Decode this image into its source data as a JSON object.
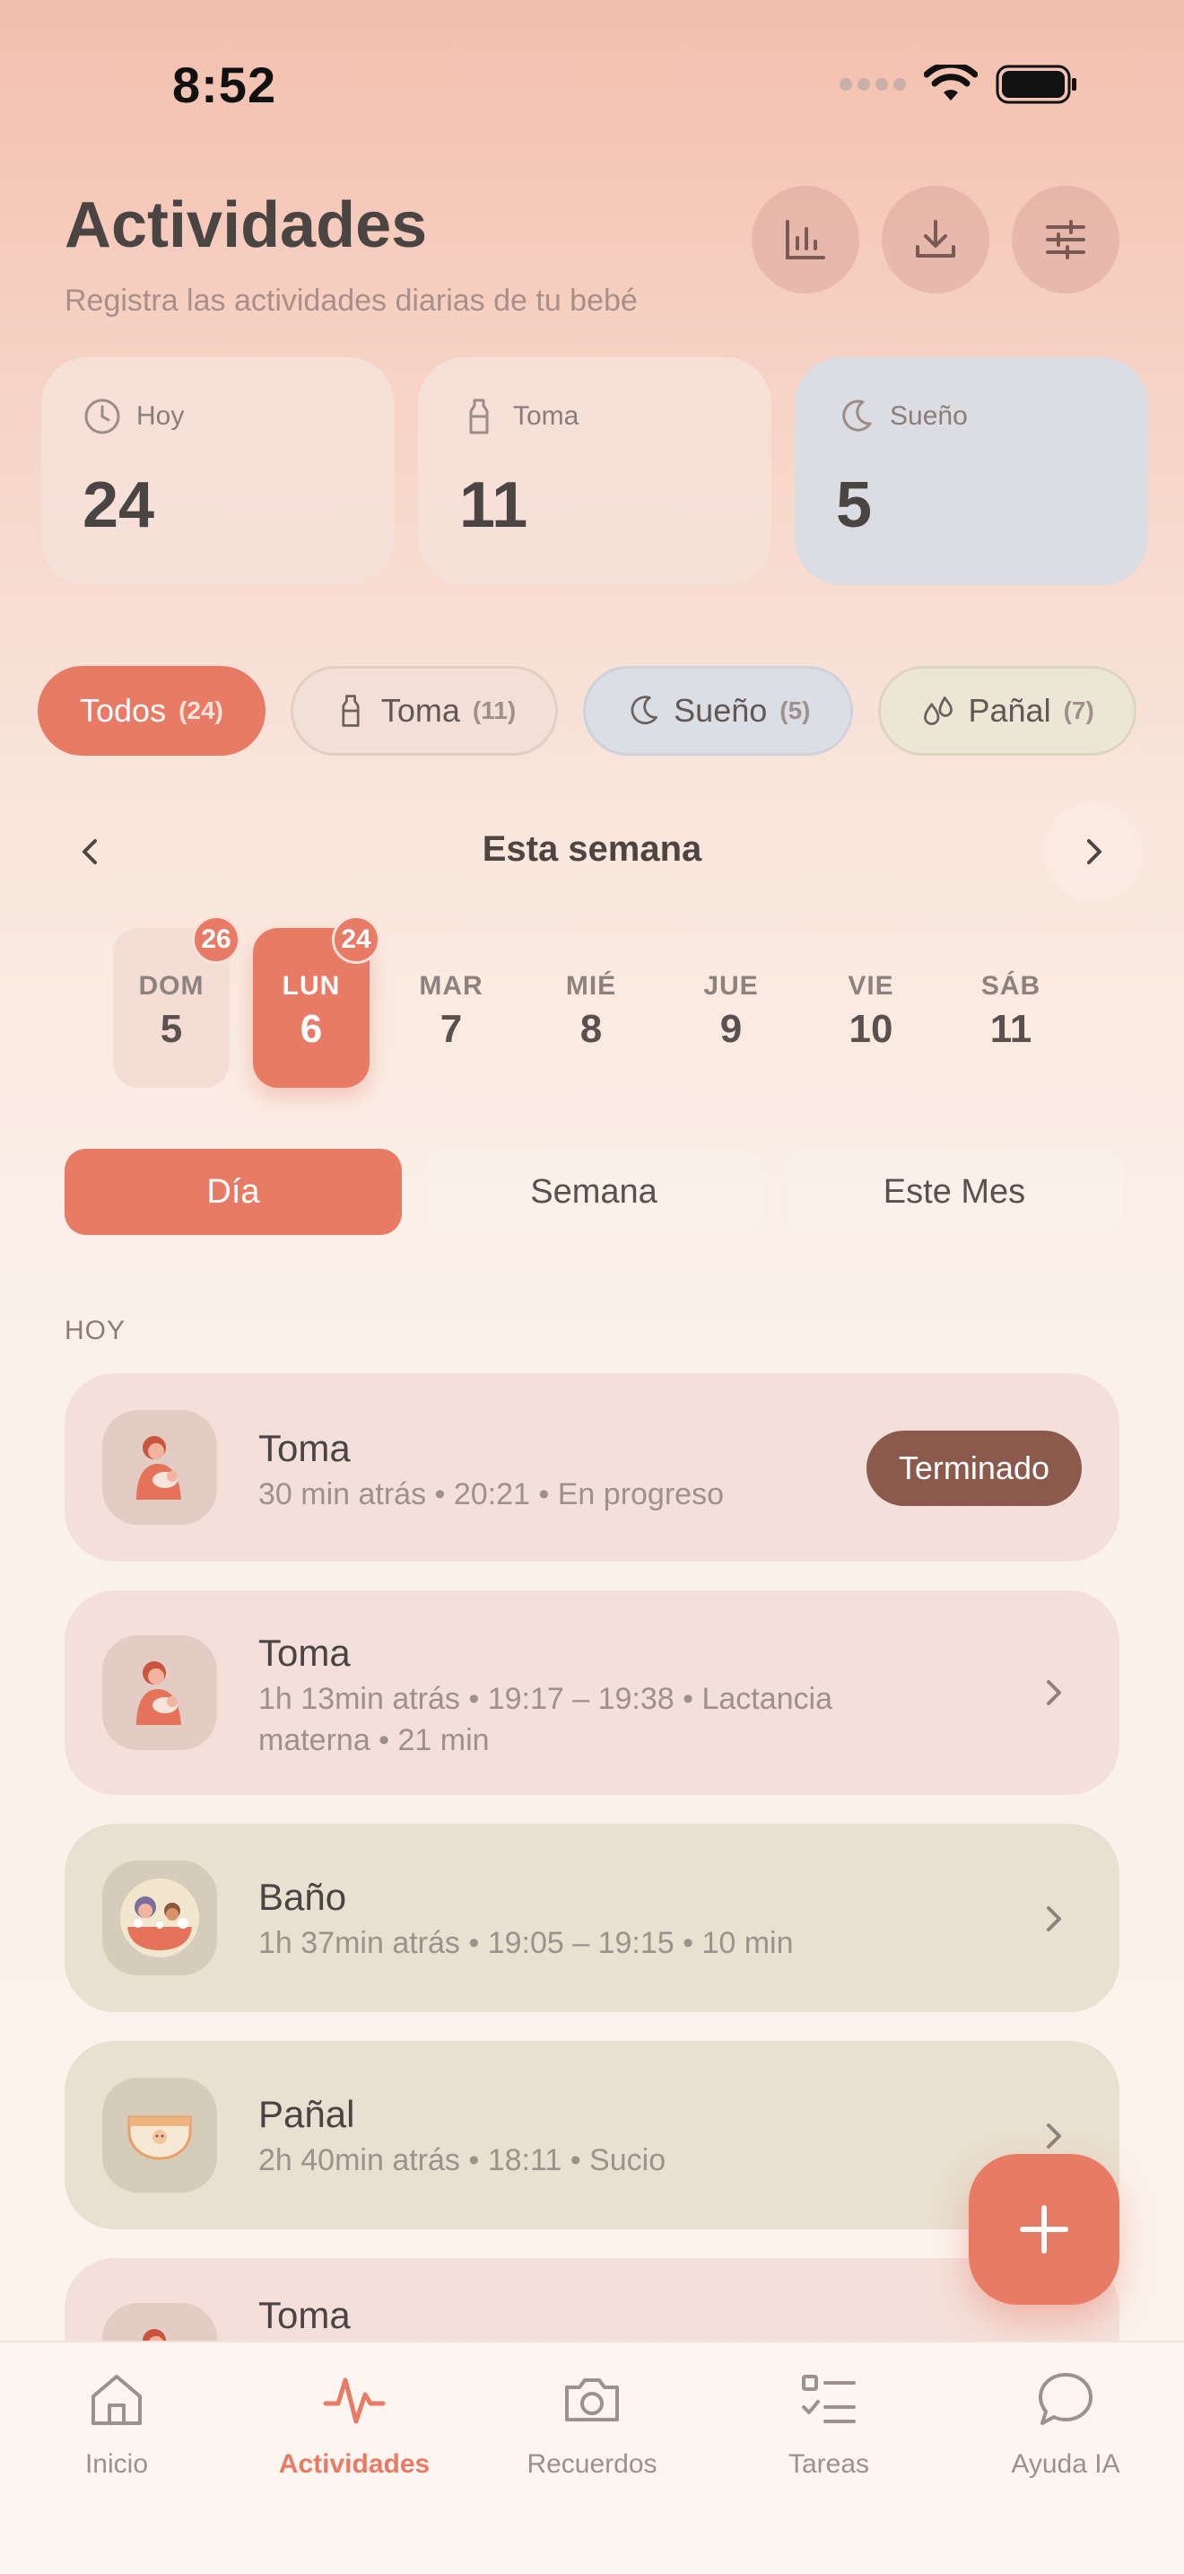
{
  "status_bar": {
    "time": "8:52"
  },
  "header": {
    "title": "Actividades",
    "subtitle": "Registra las actividades diarias de tu bebé"
  },
  "stats": [
    {
      "label": "Hoy",
      "value": "24",
      "icon": "clock-icon"
    },
    {
      "label": "Toma",
      "value": "11",
      "icon": "bottle-icon"
    },
    {
      "label": "Sueño",
      "value": "5",
      "icon": "moon-icon"
    }
  ],
  "filters": [
    {
      "label": "Todos",
      "count": "(24)"
    },
    {
      "label": "Toma",
      "count": "(11)"
    },
    {
      "label": "Sueño",
      "count": "(5)"
    },
    {
      "label": "Pañal",
      "count": "(7)"
    }
  ],
  "week": {
    "label": "Esta semana",
    "days": [
      {
        "name": "DOM",
        "num": "5",
        "badge": "26"
      },
      {
        "name": "LUN",
        "num": "6",
        "badge": "24"
      },
      {
        "name": "MAR",
        "num": "7"
      },
      {
        "name": "MIÉ",
        "num": "8"
      },
      {
        "name": "JUE",
        "num": "9"
      },
      {
        "name": "VIE",
        "num": "10"
      },
      {
        "name": "SÁB",
        "num": "11"
      }
    ]
  },
  "range_tabs": [
    "Día",
    "Semana",
    "Este Mes"
  ],
  "section_label": "HOY",
  "activities": [
    {
      "title": "Toma",
      "subtitle": "30 min atrás • 20:21 • En progreso",
      "action": "Terminado"
    },
    {
      "title": "Toma",
      "subtitle": "1h 13min atrás • 19:17 – 19:38 • Lactancia materna • 21 min"
    },
    {
      "title": "Baño",
      "subtitle": "1h 37min atrás • 19:05 – 19:15 • 10 min"
    },
    {
      "title": "Pañal",
      "subtitle": "2h 40min atrás • 18:11 • Sucio"
    },
    {
      "title": "Toma",
      "subtitle": ""
    }
  ],
  "tabs": [
    {
      "label": "Inicio",
      "icon": "home-icon"
    },
    {
      "label": "Actividades",
      "icon": "activity-icon"
    },
    {
      "label": "Recuerdos",
      "icon": "camera-icon"
    },
    {
      "label": "Tareas",
      "icon": "checklist-icon"
    },
    {
      "label": "Ayuda IA",
      "icon": "chat-icon"
    }
  ],
  "colors": {
    "accent": "#e87b65",
    "done_button": "#8b5a4c",
    "sleep_card": "#dcdde3"
  }
}
